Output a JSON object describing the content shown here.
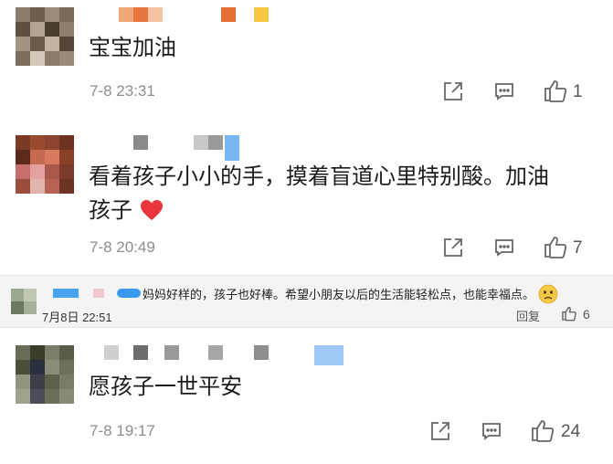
{
  "comments": [
    {
      "text": "宝宝加油",
      "time": "7-8 23:31",
      "likes": "1"
    },
    {
      "text_line1": "看着孩子小小的手，摸着盲道心里特别酸。加油",
      "text_line2": "孩子",
      "time": "7-8 20:49",
      "likes": "7"
    },
    {
      "text": "愿孩子一世平安",
      "time": "7-8 19:17",
      "likes": "24"
    }
  ],
  "reply": {
    "text": "妈妈好样的，孩子也好棒。希望小朋友以后的生活能轻松点，也能幸福点。",
    "time": "7月8日 22:51",
    "reply_label": "回复",
    "likes": "6"
  },
  "icons": [
    "share-icon",
    "comment-icon",
    "thumb-up-icon",
    "heart-emoji",
    "worried-emoji"
  ],
  "colors": {
    "heart": "#e8363a",
    "time": "#8d8d8d",
    "reply_bg": "#f4f4f4"
  }
}
